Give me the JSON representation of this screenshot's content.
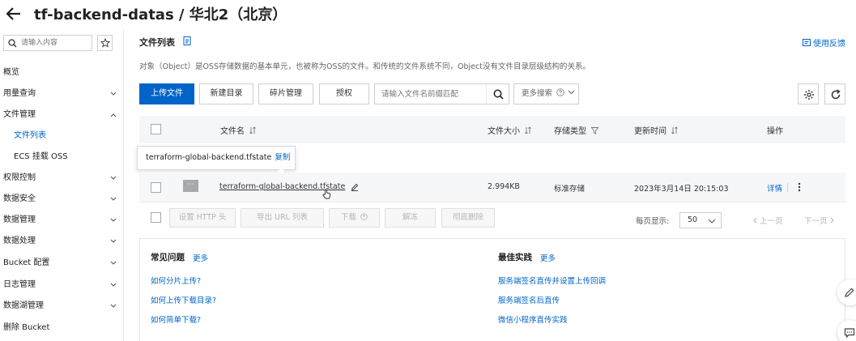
{
  "header": {
    "title": "tf-backend-datas / 华北2（北京）"
  },
  "sidebar": {
    "search_placeholder": "请输入内容",
    "items": [
      {
        "label": "概览"
      },
      {
        "label": "用量查询"
      },
      {
        "label": "文件管理"
      },
      {
        "label": "文件列表"
      },
      {
        "label": "ECS 挂载 OSS"
      },
      {
        "label": "权限控制"
      },
      {
        "label": "数据安全"
      },
      {
        "label": "数据管理"
      },
      {
        "label": "数据处理"
      },
      {
        "label": "Bucket 配置"
      },
      {
        "label": "日志管理"
      },
      {
        "label": "数据湖管理"
      },
      {
        "label": "删除 Bucket"
      }
    ]
  },
  "main": {
    "section_title": "文件列表",
    "feedback": "使用反馈",
    "description": "对象（Object）是OSS存储数据的基本单元，也被称为OSS的文件。和传统的文件系统不同，Object没有文件目录层级结构的关系。",
    "toolbar": {
      "upload": "上传文件",
      "new_dir": "新建目录",
      "fragments": "碎片管理",
      "authorize": "授权",
      "search_placeholder": "请输入文件名前缀匹配",
      "more_search": "更多搜索"
    },
    "table": {
      "headers": {
        "name": "文件名",
        "size": "文件大小",
        "storage": "存储类型",
        "updated": "更新时间",
        "actions": "操作"
      },
      "tooltip": {
        "text": "terraform-global-backend.tfstate",
        "copy": "复制"
      },
      "rows": [
        {
          "name": "terraform-global-backend.tfstate",
          "size": "2.994KB",
          "storage": "标准存储",
          "updated": "2023年3月14日 20:15:03",
          "detail": "详情"
        }
      ]
    },
    "bulk": {
      "set_http": "设置 HTTP 头",
      "export_url": "导出 URL 列表",
      "download": "下载",
      "unfreeze": "解冻",
      "delete": "彻底删除"
    },
    "pagination": {
      "per_page_label": "每页显示:",
      "per_page_value": "50",
      "prev": "上一页",
      "next": "下一页"
    },
    "help": {
      "faq_title": "常见问题",
      "faq_more": "更多",
      "faq_links": [
        "如何分片上传?",
        "如何上传下载目录?",
        "如何简单下载?"
      ],
      "best_title": "最佳实践",
      "best_more": "更多",
      "best_links": [
        "服务端签名直传并设置上传回调",
        "服务端签名后直传",
        "微信小程序直传实践"
      ]
    }
  },
  "colors": {
    "primary": "#0064c8",
    "border": "#cfcfcf",
    "header_bg": "#f5f6f7"
  }
}
